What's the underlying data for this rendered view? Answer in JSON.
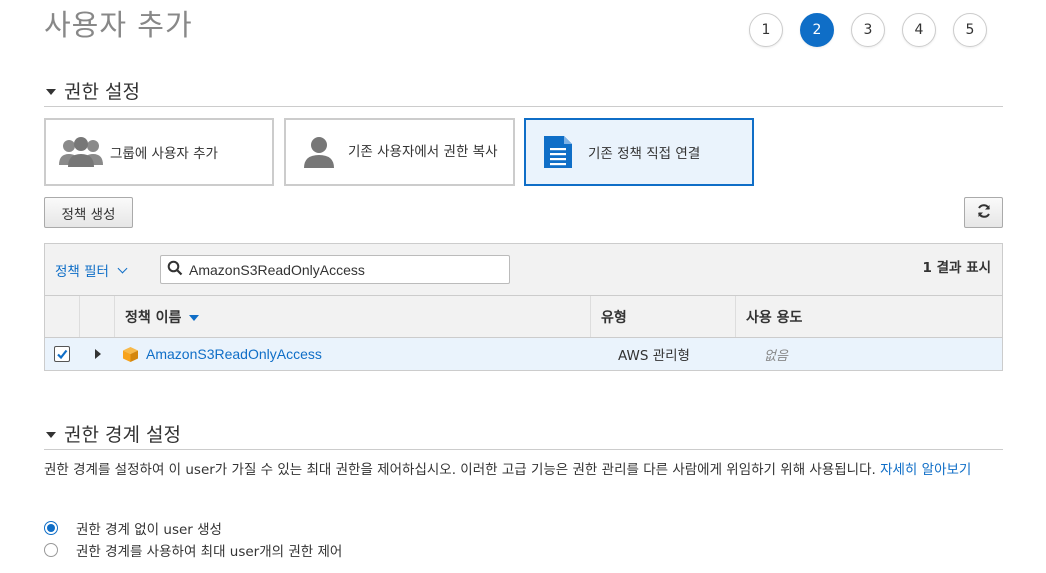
{
  "header": {
    "title": "사용자 추가",
    "steps": [
      "1",
      "2",
      "3",
      "4",
      "5"
    ],
    "active_step": "2"
  },
  "permissions": {
    "section_title": "권한 설정",
    "options": [
      {
        "label": "그룹에 사용자 추가",
        "icon": "group-users-icon",
        "selected": false
      },
      {
        "label": "기존 사용자에서 권한 복사",
        "icon": "user-icon",
        "selected": false
      },
      {
        "label": "기존 정책 직접 연결",
        "icon": "document-icon",
        "selected": true
      }
    ],
    "create_policy_label": "정책 생성",
    "refresh_icon": "refresh-icon"
  },
  "policy_table": {
    "filter_label": "정책 필터",
    "search_value": "AmazonS3ReadOnlyAccess",
    "result_count": "1 결과 표시",
    "columns": {
      "name": "정책 이름",
      "type": "유형",
      "usage": "사용 용도"
    },
    "rows": [
      {
        "checked": true,
        "name": "AmazonS3ReadOnlyAccess",
        "type": "AWS 관리형",
        "usage": "없음",
        "icon": "policy-cube-icon"
      }
    ]
  },
  "boundary": {
    "section_title": "권한 경계 설정",
    "description": "권한 경계를 설정하여 이 user가 가질 수 있는 최대 권한을 제어하십시오. 이러한 고급 기능은 권한 관리를 다른 사람에게 위임하기 위해 사용됩니다.",
    "learn_more": "자세히 알아보기",
    "radio_options": [
      {
        "label": "권한 경계 없이 user 생성",
        "selected": true
      },
      {
        "label": "권한 경계를 사용하여 최대 user개의 권한 제어",
        "selected": false
      }
    ]
  },
  "colors": {
    "accent": "#0f6ec7",
    "selected_bg": "#eaf3fc",
    "policy_icon": "#f7a21b"
  }
}
